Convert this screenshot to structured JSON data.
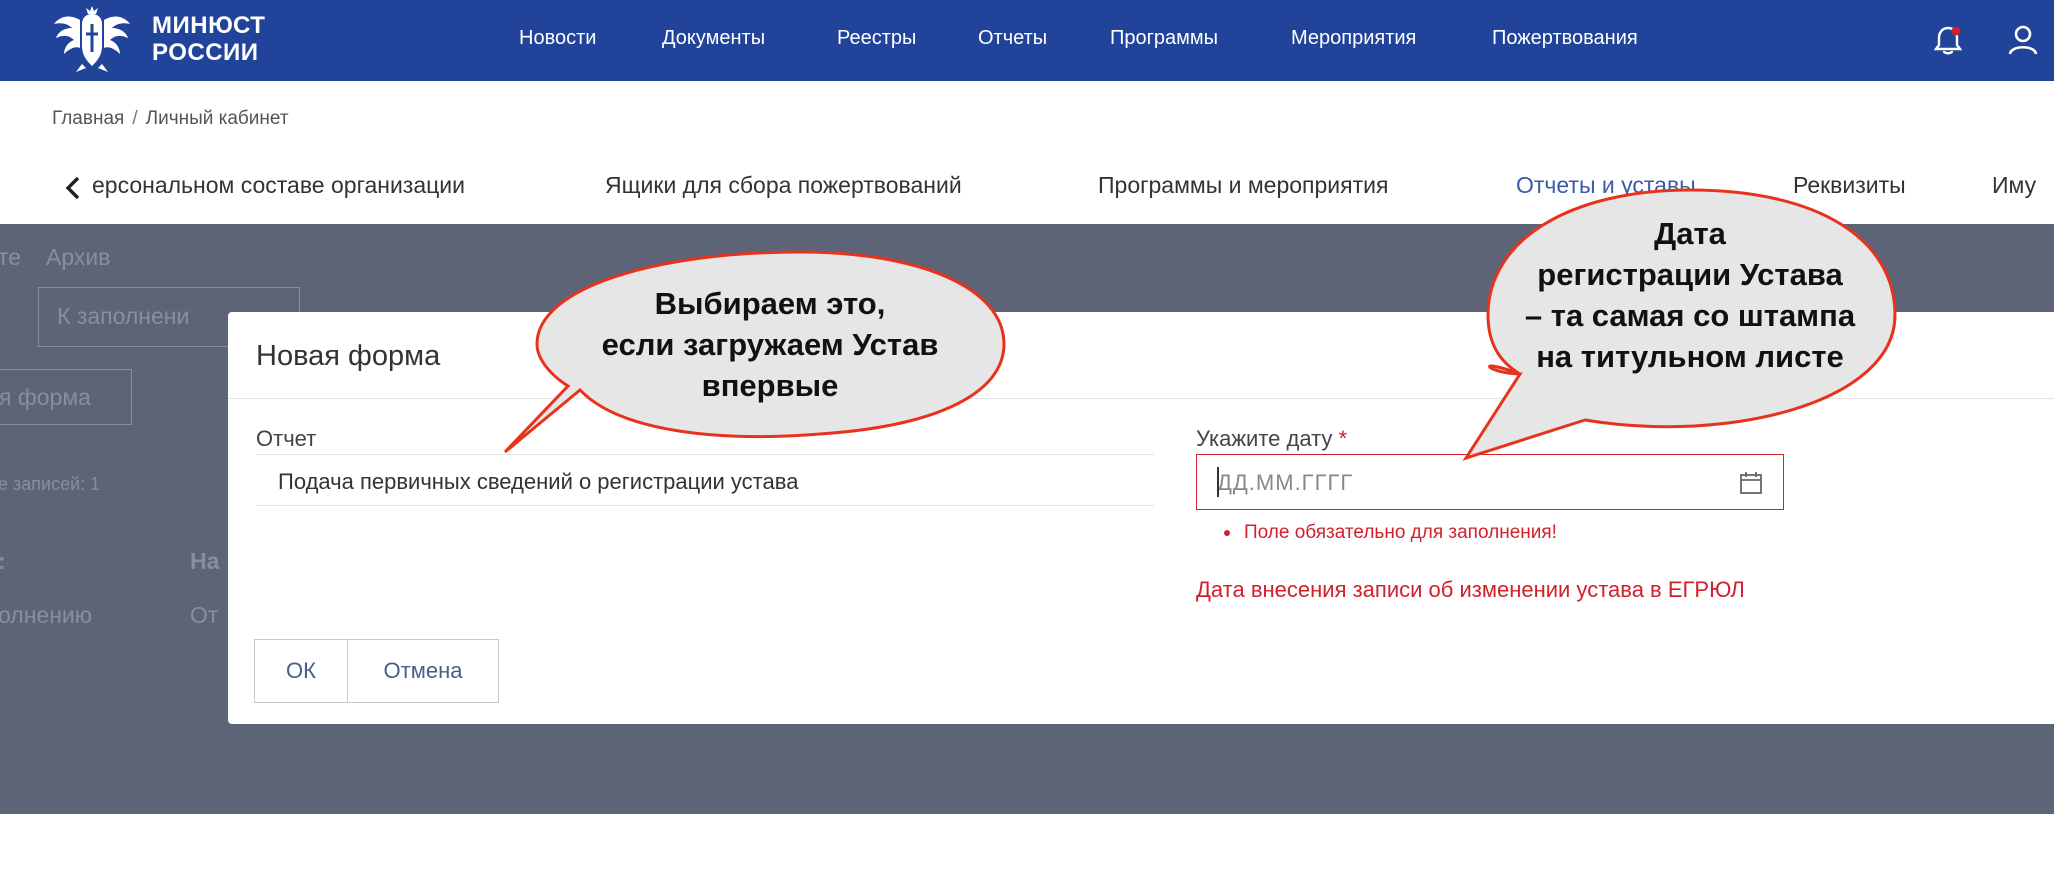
{
  "header": {
    "logo_line1": "МИНЮСТ",
    "logo_line2": "РОССИИ",
    "nav": [
      "Новости",
      "Документы",
      "Реестры",
      "Отчеты",
      "Программы",
      "Мероприятия",
      "Пожертвования"
    ],
    "icons": [
      "bell-icon",
      "user-icon"
    ],
    "colors": {
      "header_bg": "#21449a",
      "notification_dot": "#d0212c"
    }
  },
  "breadcrumb": {
    "home": "Главная",
    "separator": "/",
    "current": "Личный кабинет"
  },
  "tabs": {
    "back_icon": "chevron-left-icon",
    "items": [
      "ерсональном составе организации",
      "Ящики для сбора пожертвований",
      "Программы и мероприятия",
      "Отчеты и уставы",
      "Реквизиты",
      "Иму"
    ],
    "active": "Отчеты и уставы"
  },
  "background": {
    "filter_tail": "те",
    "archive": "Архив",
    "status_select": "К заполнени",
    "new_form_button": "я форма",
    "records_count": "е записей: 1",
    "col_left": ":",
    "col_right": "На",
    "row_left": "олнению",
    "row_right": "От"
  },
  "modal": {
    "title": "Новая форма",
    "report_label": "Отчет",
    "report_value": "Подача первичных сведений о регистрации устава",
    "date_label": "Укажите дату",
    "required_mark": "*",
    "date_placeholder": "ДД.ММ.ГГГГ",
    "error": "Поле обязательно для заполнения!",
    "hint": "Дата внесения записи об изменении устава в ЕГРЮЛ",
    "ok_label": "ОК",
    "cancel_label": "Отмена",
    "colors": {
      "error": "#d0212c",
      "overlay": "#5e6478"
    }
  },
  "callouts": {
    "left": [
      "Выбираем это,",
      "если загружаем Устав",
      "впервые"
    ],
    "right": [
      "Дата",
      "регистрации Устава",
      "– та самая со штампа",
      "на титульном листе"
    ],
    "colors": {
      "fill": "#e6e6e6",
      "stroke": "#e8321c"
    }
  }
}
